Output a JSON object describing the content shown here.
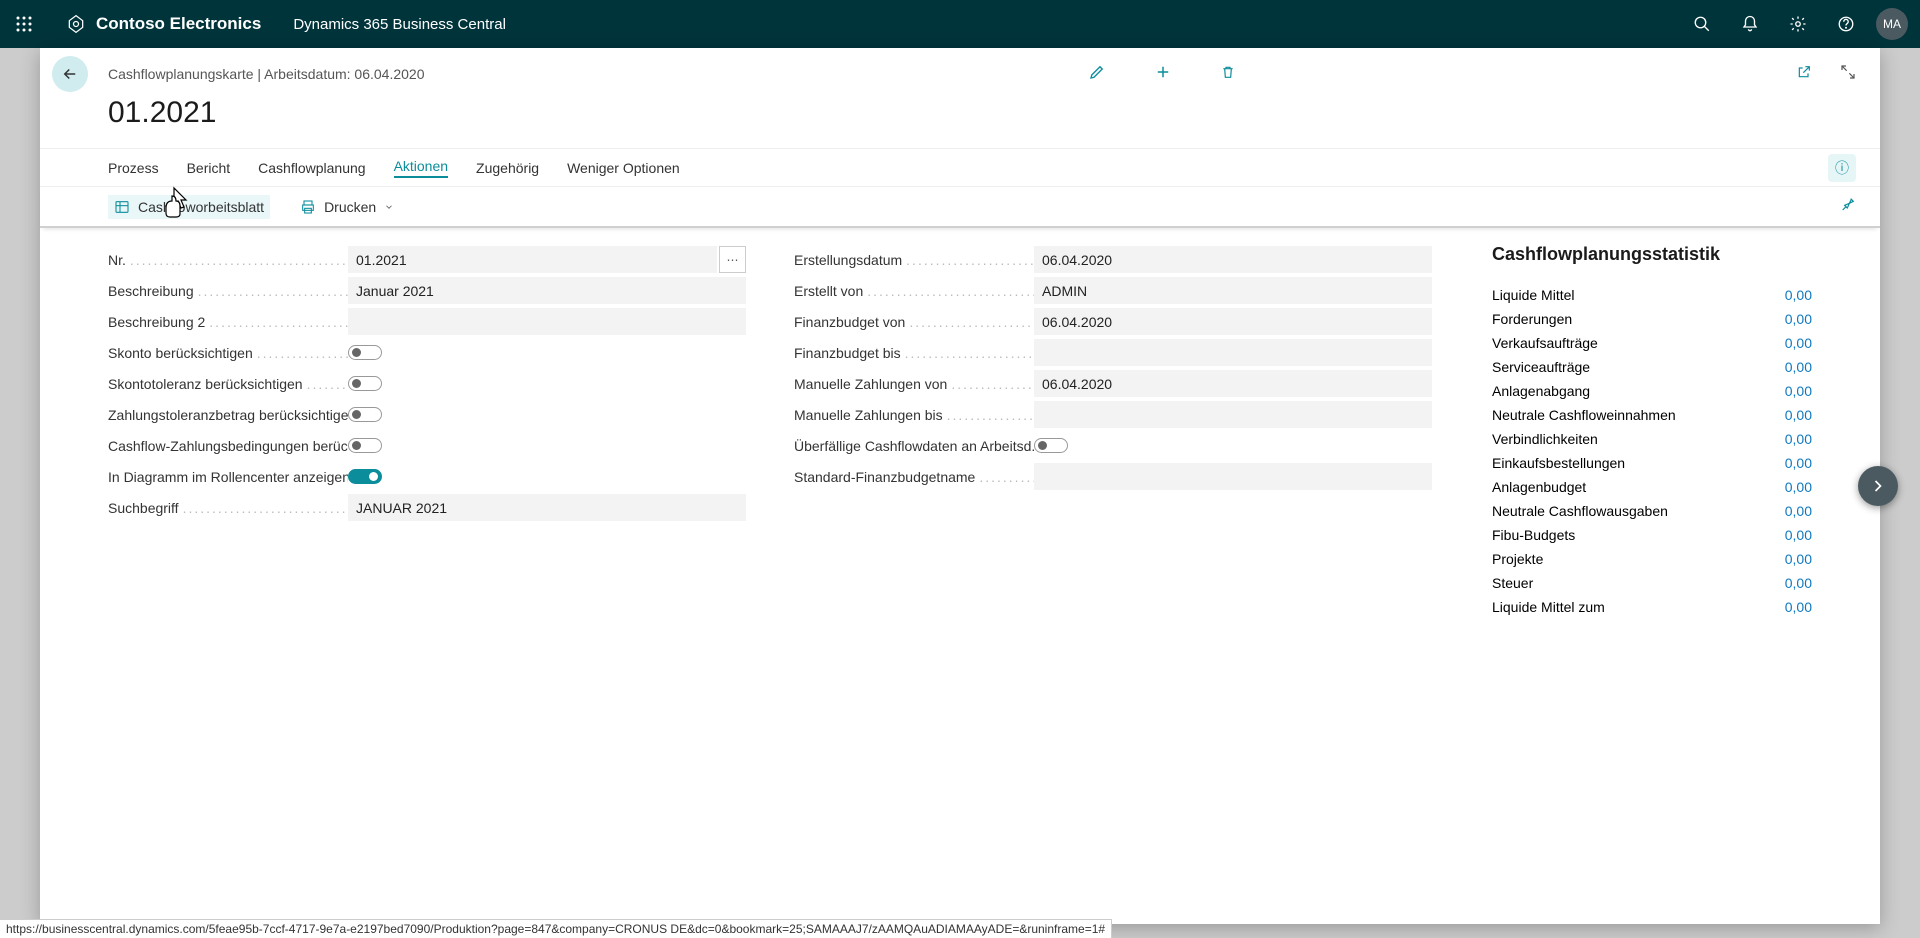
{
  "header": {
    "company": "Contoso Electronics",
    "app": "Dynamics 365 Business Central",
    "avatar": "MA"
  },
  "page": {
    "breadcrumb": "Cashflowplanungskarte | Arbeitsdatum: 06.04.2020",
    "title": "01.2021"
  },
  "menu": {
    "items": [
      "Prozess",
      "Bericht",
      "Cashflowplanung",
      "Aktionen",
      "Zugehörig",
      "Weniger Optionen"
    ],
    "active_index": 3
  },
  "ribbon": {
    "worksheet": "Cashfloworbeitsblatt",
    "print": "Drucken"
  },
  "fields_left": [
    {
      "label": "Nr.",
      "value": "01.2021",
      "type": "text",
      "more": true
    },
    {
      "label": "Beschreibung",
      "value": "Januar 2021",
      "type": "text"
    },
    {
      "label": "Beschreibung 2",
      "value": "",
      "type": "text"
    },
    {
      "label": "Skonto berücksichtigen",
      "value": false,
      "type": "toggle"
    },
    {
      "label": "Skontotoleranz berücksichtigen",
      "value": false,
      "type": "toggle"
    },
    {
      "label": "Zahlungstoleranzbetrag berücksichtigen",
      "value": false,
      "type": "toggle"
    },
    {
      "label": "Cashflow-Zahlungsbedingungen berüc...",
      "value": false,
      "type": "toggle",
      "trunc": true
    },
    {
      "label": "In Diagramm im Rollencenter anzeigen",
      "value": true,
      "type": "toggle"
    },
    {
      "label": "Suchbegriff",
      "value": "JANUAR 2021",
      "type": "text"
    }
  ],
  "fields_right": [
    {
      "label": "Erstellungsdatum",
      "value": "06.04.2020",
      "type": "text"
    },
    {
      "label": "Erstellt von",
      "value": "ADMIN",
      "type": "text"
    },
    {
      "label": "Finanzbudget von",
      "value": "06.04.2020",
      "type": "text"
    },
    {
      "label": "Finanzbudget bis",
      "value": "",
      "type": "text"
    },
    {
      "label": "Manuelle Zahlungen von",
      "value": "06.04.2020",
      "type": "text"
    },
    {
      "label": "Manuelle Zahlungen bis",
      "value": "",
      "type": "text"
    },
    {
      "label": "Überfällige Cashflowdaten an Arbeitsd...",
      "value": false,
      "type": "toggle",
      "trunc": true
    },
    {
      "label": "Standard-Finanzbudgetname",
      "value": "",
      "type": "text"
    }
  ],
  "stats": {
    "title": "Cashflowplanungsstatistik",
    "rows": [
      {
        "label": "Liquide Mittel",
        "value": "0,00"
      },
      {
        "label": "Forderungen",
        "value": "0,00"
      },
      {
        "label": "Verkaufsaufträge",
        "value": "0,00"
      },
      {
        "label": "Serviceaufträge",
        "value": "0,00"
      },
      {
        "label": "Anlagenabgang",
        "value": "0,00"
      },
      {
        "label": "Neutrale Cashfloweinnahmen",
        "value": "0,00"
      },
      {
        "label": "Verbindlichkeiten",
        "value": "0,00"
      },
      {
        "label": "Einkaufsbestellungen",
        "value": "0,00"
      },
      {
        "label": "Anlagenbudget",
        "value": "0,00"
      },
      {
        "label": "Neutrale Cashflowausgaben",
        "value": "0,00"
      },
      {
        "label": "Fibu-Budgets",
        "value": "0,00"
      },
      {
        "label": "Projekte",
        "value": "0,00"
      },
      {
        "label": "Steuer",
        "value": "0,00"
      },
      {
        "label": "Liquide Mittel zum",
        "value": "0,00"
      }
    ]
  },
  "status_url": "https://businesscentral.dynamics.com/5feae95b-7ccf-4717-9e7a-e2197bed7090/Produktion?page=847&company=CRONUS DE&dc=0&bookmark=25;SAMAAAJ7/zAAMQAuADIAMAAyADE=&runinframe=1#"
}
